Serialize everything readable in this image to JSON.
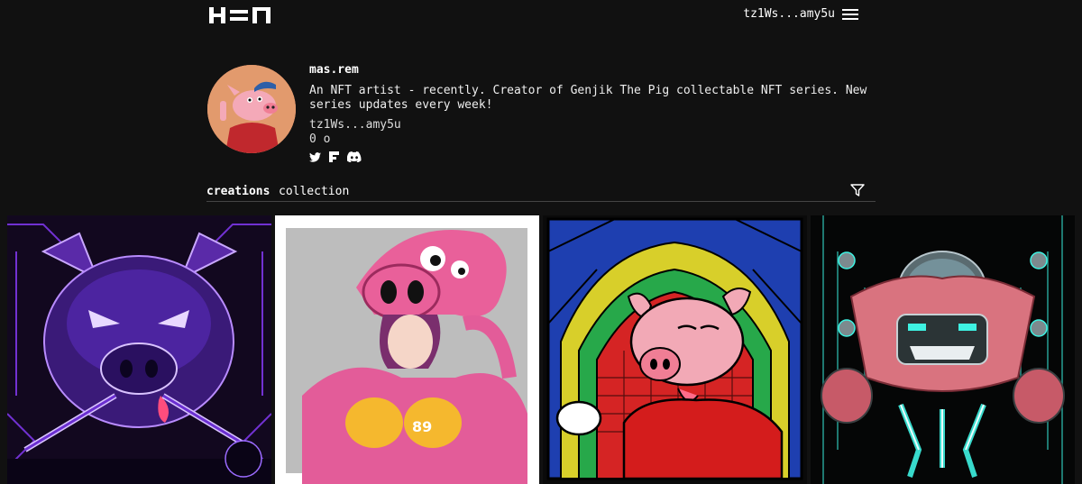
{
  "header": {
    "logo": "H=N",
    "wallet_address": "tz1Ws...amy5u"
  },
  "profile": {
    "username": "mas.rem",
    "bio": "An NFT artist - recently. Creator of Genjik The Pig collectable NFT series. New series updates every week!",
    "address": "tz1Ws...amy5u",
    "followers": "0 o",
    "socials": [
      "twitter-icon",
      "flickr-icon",
      "discord-icon"
    ]
  },
  "tabs": {
    "creations": "creations",
    "collection": "collection"
  },
  "gallery": {
    "items": [
      "purple-pig-artwork",
      "pink-pig-hat-girl-artwork",
      "stained-glass-pig-artwork",
      "mecha-pig-artwork"
    ]
  },
  "colors": {
    "background": "#111111",
    "text": "#ffffff"
  }
}
